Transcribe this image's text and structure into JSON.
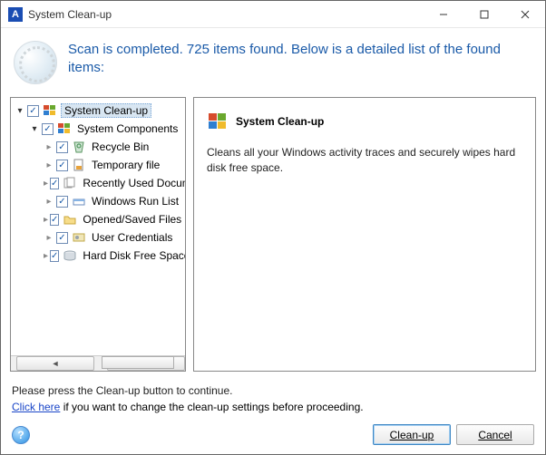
{
  "window": {
    "title": "System Clean-up",
    "app_letter": "A"
  },
  "header": {
    "line": "Scan is completed. 725 items found. Below is a detailed list of the found items:"
  },
  "tree": {
    "root": {
      "label": "System Clean-up"
    },
    "group": {
      "label": "System Components"
    },
    "items": [
      {
        "label": "Recycle Bin"
      },
      {
        "label": "Temporary file"
      },
      {
        "label": "Recently Used Documents"
      },
      {
        "label": "Windows Run List"
      },
      {
        "label": "Opened/Saved Files History"
      },
      {
        "label": "User Credentials"
      },
      {
        "label": "Hard Disk Free Space"
      }
    ]
  },
  "detail": {
    "title": "System Clean-up",
    "body": "Cleans all your Windows activity traces and securely wipes hard disk free space."
  },
  "footer": {
    "instruction": "Please press the Clean-up button to continue.",
    "link_text": "Click here",
    "link_rest": " if you want to change the clean-up settings before proceeding.",
    "cleanup_btn": "Clean-up",
    "cancel_btn": "Cancel"
  }
}
